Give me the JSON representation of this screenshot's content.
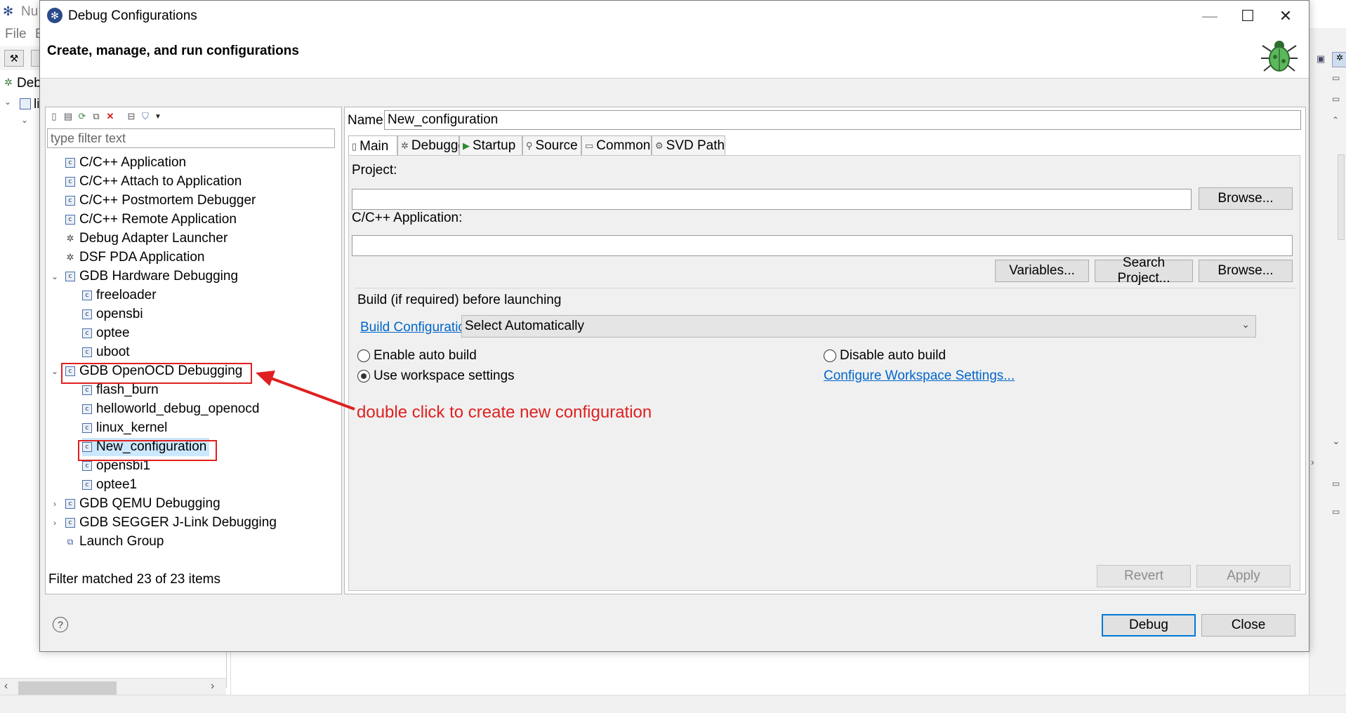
{
  "background_app": {
    "title_partial": "Nu",
    "menu": [
      "File",
      "E"
    ],
    "left_view_label": "Deb",
    "left_tree_partial": "li"
  },
  "dialog": {
    "title": "Debug Configurations",
    "header_title": "Create, manage, and run configurations",
    "window_buttons": {
      "minimize": "—",
      "maximize": "☐",
      "close": "✕"
    }
  },
  "left_panel": {
    "filter_placeholder": "type filter text",
    "tree": [
      {
        "label": "C/C++ Application",
        "icon": "c-config-icon",
        "level": 0
      },
      {
        "label": "C/C++ Attach to Application",
        "icon": "c-config-icon",
        "level": 0
      },
      {
        "label": "C/C++ Postmortem Debugger",
        "icon": "c-config-icon",
        "level": 0
      },
      {
        "label": "C/C++ Remote Application",
        "icon": "c-config-icon",
        "level": 0
      },
      {
        "label": "Debug Adapter Launcher",
        "icon": "bug-icon",
        "level": 0
      },
      {
        "label": "DSF PDA Application",
        "icon": "bug-icon",
        "level": 0
      },
      {
        "label": "GDB Hardware Debugging",
        "icon": "c-config-icon",
        "level": 0,
        "expanded": true
      },
      {
        "label": "freeloader",
        "icon": "c-config-icon",
        "level": 1
      },
      {
        "label": "opensbi",
        "icon": "c-config-icon",
        "level": 1
      },
      {
        "label": "optee",
        "icon": "c-config-icon",
        "level": 1
      },
      {
        "label": "uboot",
        "icon": "c-config-icon",
        "level": 1
      },
      {
        "label": "GDB OpenOCD Debugging",
        "icon": "c-config-icon",
        "level": 0,
        "expanded": true,
        "highlighted": true
      },
      {
        "label": "flash_burn",
        "icon": "c-config-icon",
        "level": 1
      },
      {
        "label": "helloworld_debug_openocd",
        "icon": "c-config-icon",
        "level": 1
      },
      {
        "label": "linux_kernel",
        "icon": "c-config-icon",
        "level": 1
      },
      {
        "label": "New_configuration",
        "icon": "c-config-icon",
        "level": 1,
        "selected": true,
        "highlighted": true
      },
      {
        "label": "opensbi1",
        "icon": "c-config-icon",
        "level": 1
      },
      {
        "label": "optee1",
        "icon": "c-config-icon",
        "level": 1
      },
      {
        "label": "GDB QEMU Debugging",
        "icon": "c-config-icon",
        "level": 0,
        "expanded": false
      },
      {
        "label": "GDB SEGGER J-Link Debugging",
        "icon": "c-config-icon",
        "level": 0,
        "expanded": false
      },
      {
        "label": "Launch Group",
        "icon": "launch-group-icon",
        "level": 0
      }
    ],
    "filter_status": "Filter matched 23 of 23 items"
  },
  "right_panel": {
    "name_label": "Name:",
    "name_value": "New_configuration",
    "tabs": [
      {
        "label": "Main",
        "icon": "page-icon",
        "active": true
      },
      {
        "label": "Debugger",
        "icon": "bug-icon"
      },
      {
        "label": "Startup",
        "icon": "play-icon"
      },
      {
        "label": "Source",
        "icon": "source-icon"
      },
      {
        "label": "Common",
        "icon": "common-icon"
      },
      {
        "label": "SVD Path",
        "icon": "svd-icon"
      }
    ],
    "project_label": "Project:",
    "project_value": "",
    "browse_label": "Browse...",
    "app_label": "C/C++ Application:",
    "app_value": "",
    "variables_label": "Variables...",
    "search_project_label": "Search Project...",
    "browse2_label": "Browse...",
    "build_group_label": "Build (if required) before launching",
    "build_config_link": "Build Configuration:",
    "build_config_value": "Select Automatically",
    "radio_enable": "Enable auto build",
    "radio_disable": "Disable auto build",
    "radio_workspace": "Use workspace settings",
    "configure_link": "Configure Workspace Settings...",
    "revert_label": "Revert",
    "apply_label": "Apply"
  },
  "footer": {
    "help_icon": "?",
    "debug_label": "Debug",
    "close_label": "Close"
  },
  "annotation": {
    "text": "double click to create new configuration",
    "color": "#e02020"
  }
}
